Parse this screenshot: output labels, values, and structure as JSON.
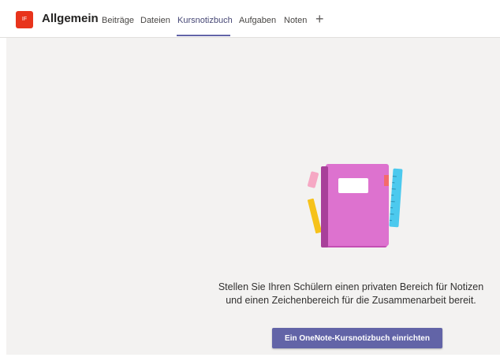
{
  "team": {
    "avatar_initials": "IF",
    "avatar_color": "#e8341c"
  },
  "channel": {
    "name": "Allgemein"
  },
  "tabs": [
    {
      "label": "Beiträge",
      "active": false
    },
    {
      "label": "Dateien",
      "active": false
    },
    {
      "label": "Kursnotizbuch",
      "active": true
    },
    {
      "label": "Aufgaben",
      "active": false
    },
    {
      "label": "Noten",
      "active": false
    }
  ],
  "add_tab": {
    "icon": "plus-icon",
    "glyph": "+"
  },
  "empty_state": {
    "message_line1": "Stellen Sie Ihren Schülern einen privaten Bereich für Notizen",
    "message_line2": "und einen Zeichenbereich für die Zusammenarbeit bereit.",
    "button_label": "Ein OneNote-Kursnotizbuch einrichten",
    "illustration": "notebook-illustration"
  },
  "colors": {
    "accent": "#6264a7",
    "background": "#f3f2f1",
    "notebook": "#d865c8",
    "ruler": "#4cc9ee",
    "pencil": "#f6c21b"
  }
}
